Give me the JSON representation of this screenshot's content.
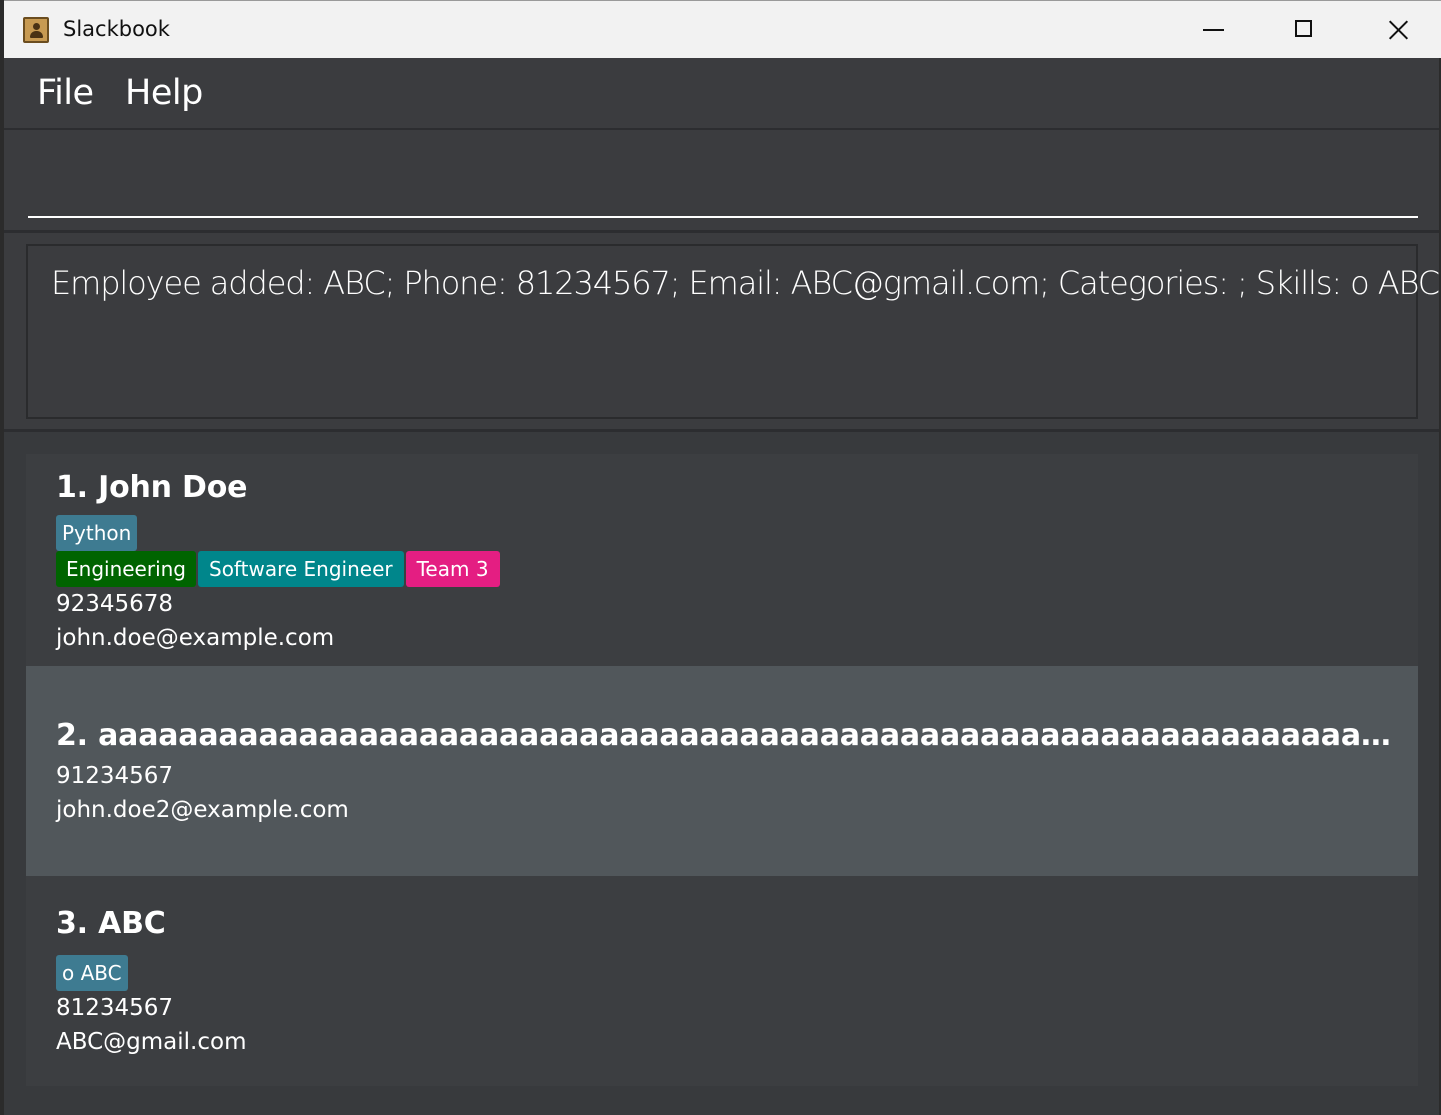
{
  "window": {
    "title": "Slackbook",
    "icon": "contacts-book-icon"
  },
  "menu": {
    "items": [
      {
        "label": "File"
      },
      {
        "label": "Help"
      }
    ]
  },
  "command": {
    "value": "",
    "placeholder": ""
  },
  "result": {
    "text": "Employee added: ABC; Phone: 81234567; Email: ABC@gmail.com; Categories: ; Skills: o ABC"
  },
  "employees": [
    {
      "name": "1. John Doe",
      "skills": [
        "Python"
      ],
      "categories": [
        "Engineering",
        "Software Engineer",
        "Team 3"
      ],
      "phone": "92345678",
      "email": "john.doe@example.com",
      "selected": false
    },
    {
      "name": "2. aaaaaaaaaaaaaaaaaaaaaaaaaaaaaaaaaaaaaaaaaaaaaaaaaaaaaaaaaaaaaaaaaaaaaaa aaa...",
      "skills": [],
      "categories": [],
      "phone": "91234567",
      "email": "john.doe2@example.com",
      "selected": true
    },
    {
      "name": "3. ABC",
      "skills": [
        "o ABC"
      ],
      "categories": [],
      "phone": "81234567",
      "email": "ABC@gmail.com",
      "selected": false
    }
  ],
  "colors": {
    "background": "#383a3d",
    "card": "#3c3e41",
    "card_selected": "#51575b",
    "skill_tag": "#3e7b91",
    "category_engineering": "#006400",
    "category_software_engineer": "#00868b",
    "category_team": "#e41e82"
  }
}
